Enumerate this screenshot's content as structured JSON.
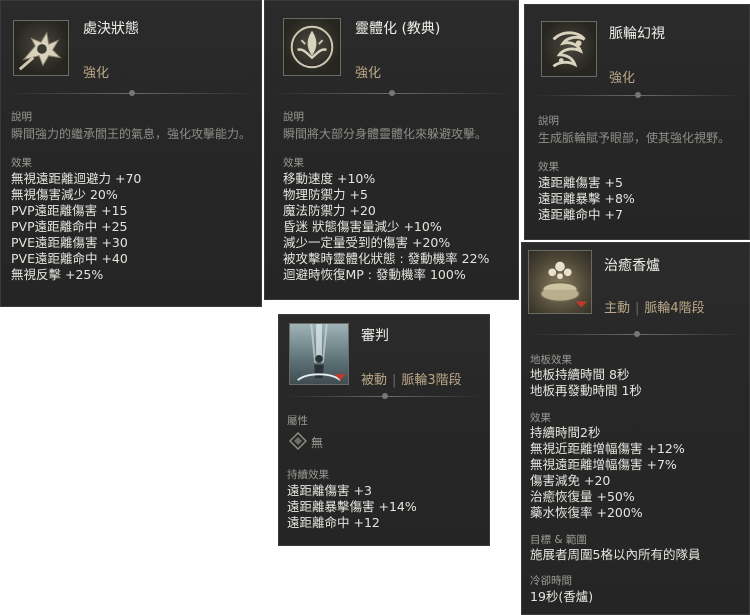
{
  "card1": {
    "name": "處決狀態",
    "subtitle": "強化",
    "icon": "execution-state-icon",
    "desc_label": "說明",
    "desc": "瞬間強力的繼承閻王的氣息，強化攻擊能力。",
    "effect_label": "效果",
    "effects": [
      "無視遠距離迴避力 +70",
      "無視傷害減少 20%",
      "PVP遠距離傷害 +15",
      "PVP遠距離命中 +25",
      "PVE遠距離傷害 +30",
      "PVE遠距離命中 +40",
      "無視反擊 +25%"
    ]
  },
  "card2": {
    "name": "靈體化 (教典)",
    "subtitle": "強化",
    "icon": "spirit-form-icon",
    "desc_label": "說明",
    "desc": "瞬間將大部分身體靈體化來躲避攻擊。",
    "effect_label": "效果",
    "effects": [
      "移動速度 +10%",
      "物理防禦力 +5",
      "魔法防禦力 +20",
      "昏迷 狀態傷害量減少 +10%",
      "減少一定量受到的傷害 +20%",
      "被攻擊時靈體化狀態 : 發動機率 22%",
      "迴避時恢復MP : 發動機率 100%"
    ]
  },
  "card3": {
    "name": "脈輪幻視",
    "subtitle": "強化",
    "icon": "chakra-vision-icon",
    "desc_label": "說明",
    "desc": "生成脈輪賦予眼部，使其強化視野。",
    "effect_label": "效果",
    "effects": [
      "遠距離傷害 +5",
      "遠距離暴擊 +8%",
      "遠距離命中 +7"
    ]
  },
  "card4": {
    "name": "審判",
    "type": "被動",
    "tier": "脈輪3階段",
    "icon": "judgment-icon",
    "attr_label": "屬性",
    "attr_value": "無",
    "attr_icon": "diamond-attribute-icon",
    "effect_label": "持續效果",
    "effects": [
      "遠距離傷害 +3",
      "遠距離暴擊傷害 +14%",
      "遠距離命中 +12"
    ]
  },
  "card5": {
    "name": "治癒香爐",
    "type": "主動",
    "tier": "脈輪4階段",
    "icon": "healing-censer-icon",
    "floor_label": "地板效果",
    "floor_effects": [
      "地板持續時間 8秒",
      "地板再發動時間 1秒"
    ],
    "effect_label": "效果",
    "effects": [
      "持續時間2秒",
      "無視近距離增幅傷害 +12%",
      "無視遠距離增幅傷害 +7%",
      "傷害減免 +20",
      "治癒恢復量 +50%",
      "藥水恢復率 +200%"
    ],
    "target_label": "目標 & 範圍",
    "target": "施展者周圍5格以內所有的隊員",
    "cooldown_label": "冷卻時間",
    "cooldown": "19秒(香爐)"
  }
}
